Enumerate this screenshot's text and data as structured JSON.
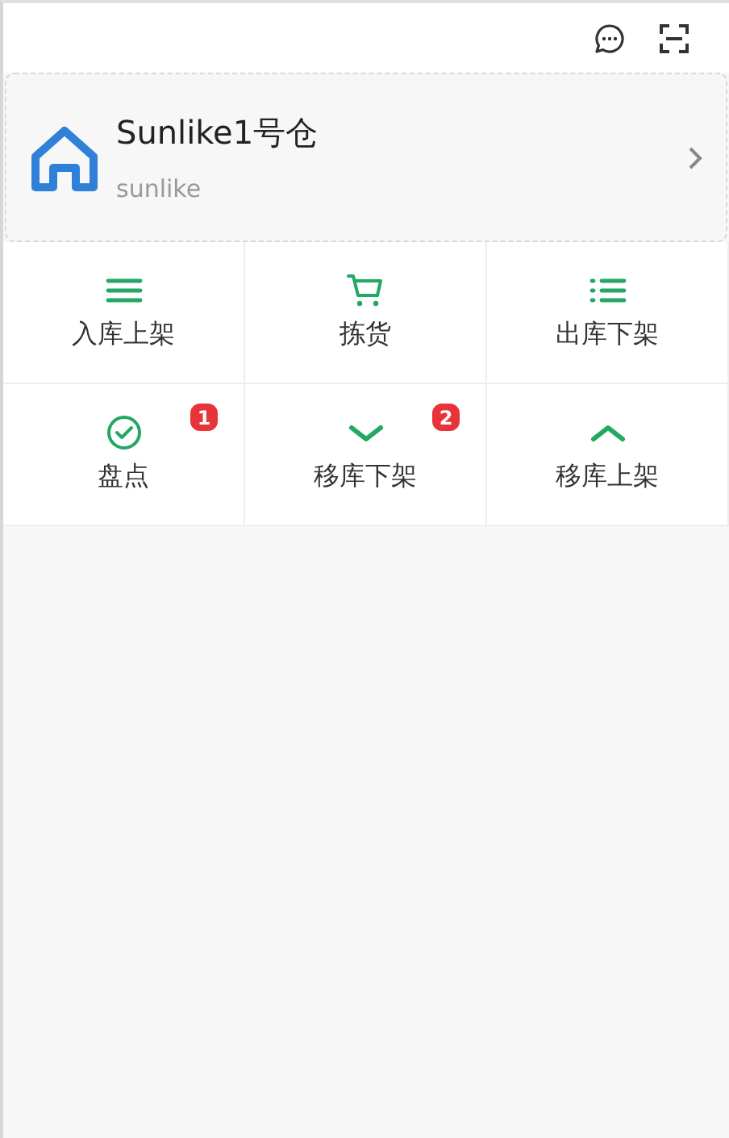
{
  "warehouse": {
    "name": "Sunlike1号仓",
    "code": "sunlike"
  },
  "menu": [
    {
      "label": "入库上架",
      "kind": "lines"
    },
    {
      "label": "拣货",
      "kind": "cart"
    },
    {
      "label": "出库下架",
      "kind": "list"
    },
    {
      "label": "盘点",
      "kind": "check",
      "badge": "1"
    },
    {
      "label": "移库下架",
      "kind": "down",
      "badge": "2"
    },
    {
      "label": "移库上架",
      "kind": "up"
    }
  ]
}
